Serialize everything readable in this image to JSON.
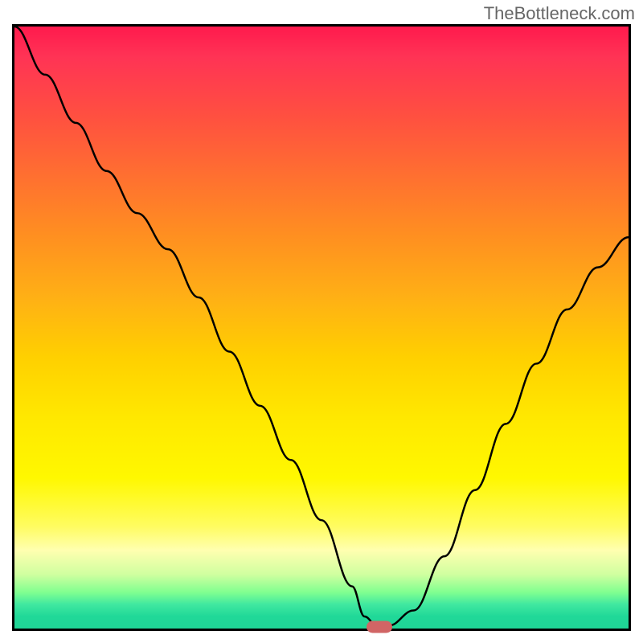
{
  "watermark": "TheBottleneck.com",
  "chart_data": {
    "type": "line",
    "title": "",
    "xlabel": "",
    "ylabel": "",
    "xlim": [
      0,
      100
    ],
    "ylim": [
      0,
      100
    ],
    "x": [
      0,
      5,
      10,
      15,
      20,
      25,
      30,
      35,
      40,
      45,
      50,
      55,
      57,
      59,
      61,
      65,
      70,
      75,
      80,
      85,
      90,
      95,
      100
    ],
    "values": [
      100,
      92,
      84,
      76,
      69,
      63,
      55,
      46,
      37,
      28,
      18,
      7,
      2,
      0.5,
      0.5,
      3,
      12,
      23,
      34,
      44,
      53,
      60,
      65
    ],
    "marker_x": 59,
    "marker_y": 0.5,
    "gradient_colors": {
      "top": "#ff1a4d",
      "middle": "#ffe800",
      "bottom": "#1fd596"
    }
  }
}
